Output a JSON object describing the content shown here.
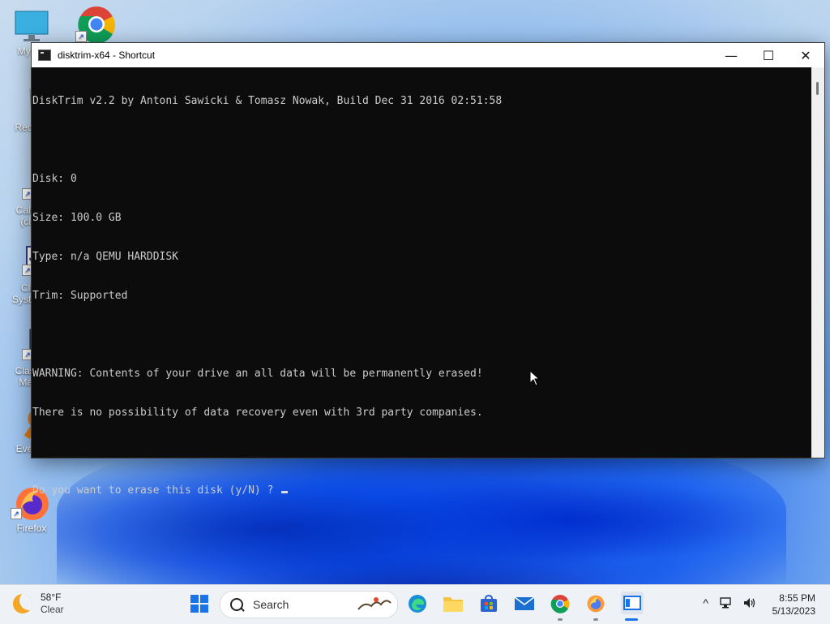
{
  "desktop": {
    "icons": [
      {
        "label": "My Computer",
        "icon": "monitor-icon"
      },
      {
        "label": "Google Chrome",
        "icon": "chrome-icon"
      },
      {
        "label": "Recycle Bin",
        "icon": "recycle-bin-icon"
      },
      {
        "label": "Calculator (classic)",
        "icon": "calculator-icon"
      },
      {
        "label": "Classic System",
        "icon": "system-icon"
      },
      {
        "label": "Classic Manager",
        "icon": "manager-icon"
      },
      {
        "label": "Everything",
        "icon": "search-magnifier-icon"
      },
      {
        "label": "Firefox",
        "icon": "firefox-icon"
      }
    ],
    "visible_labels": [
      "My Co",
      "",
      "Recyc",
      "Calcu\n(cla",
      "Cla\nSystem",
      "Classi\nMan",
      "Every",
      "Firefox"
    ]
  },
  "window": {
    "title": "disktrim-x64 - Shortcut",
    "minimize_glyph": "—",
    "maximize_glyph": "☐",
    "close_glyph": "✕"
  },
  "console": {
    "lines": [
      "DiskTrim v2.2 by Antoni Sawicki & Tomasz Nowak, Build Dec 31 2016 02:51:58",
      "",
      "Disk: 0",
      "Size: 100.0 GB",
      "Type: n/a QEMU HARDDISK",
      "Trim: Supported",
      "",
      "WARNING: Contents of your drive an all data will be permanently erased!",
      "There is no possibility of data recovery even with 3rd party companies.",
      "",
      "Do you want to erase this disk (y/N) ? "
    ]
  },
  "taskbar": {
    "weather_temp": "58°F",
    "weather_desc": "Clear",
    "search_label": "Search",
    "time": "8:55 PM",
    "date": "5/13/2023",
    "chevron": "^"
  },
  "colors": {
    "console_bg": "#0c0c0c",
    "console_fg": "#cccccc",
    "accent": "#1a73e8"
  }
}
